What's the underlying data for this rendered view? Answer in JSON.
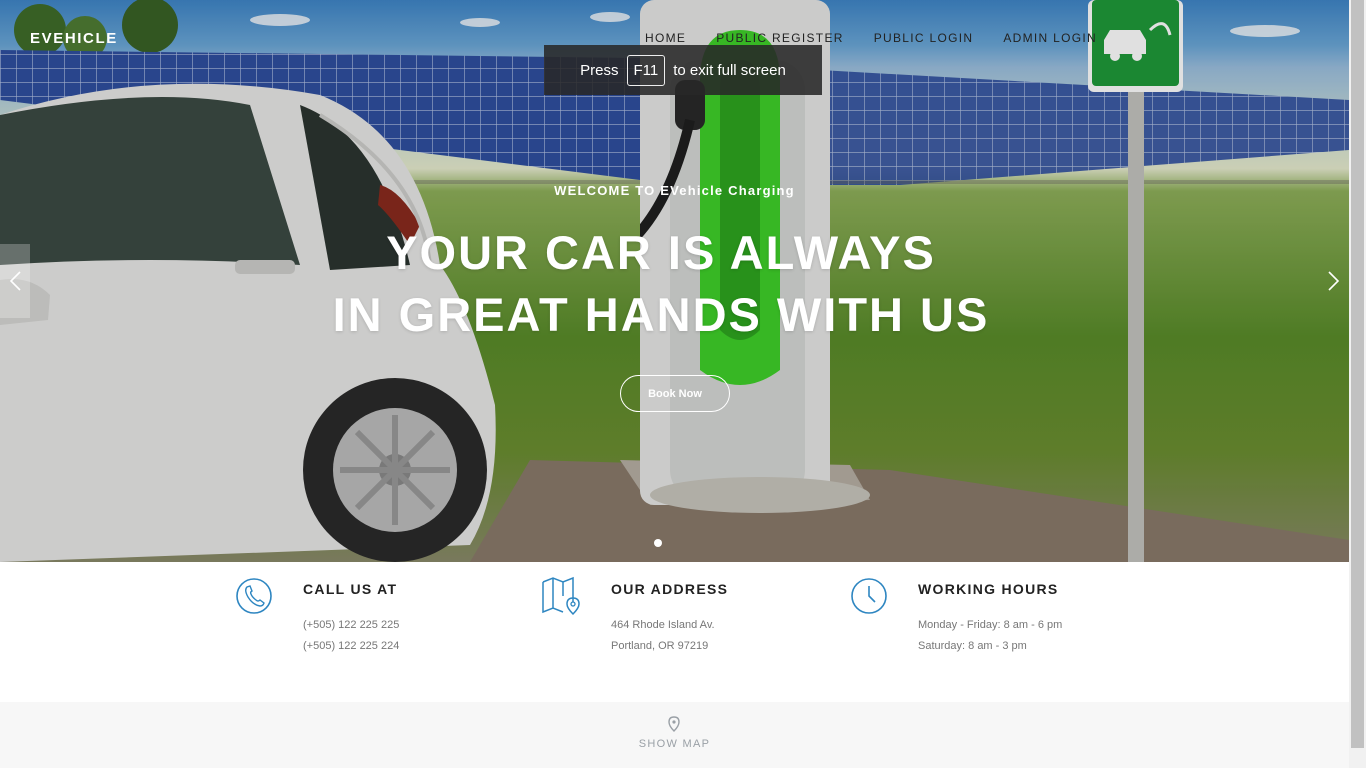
{
  "brand": "EVEHICLE",
  "nav": {
    "home": "HOME",
    "public_register": "PUBLIC REGISTER",
    "public_login": "PUBLIC LOGIN",
    "admin_login": "ADMIN LOGIN"
  },
  "fullscreen_notice": {
    "before": "Press",
    "key": "F11",
    "after": "to exit full screen"
  },
  "hero": {
    "welcome": "WELCOME TO EVehicle Charging",
    "headline_line1": "YOUR CAR IS ALWAYS",
    "headline_line2": "IN GREAT HANDS WITH US",
    "cta": "Book Now",
    "prev_icon": "chevron-left-icon",
    "next_icon": "chevron-right-icon",
    "slide_count": 1,
    "active_slide": 1
  },
  "info": {
    "call": {
      "icon": "phone-icon",
      "title": "CALL US AT",
      "line1": "(+505) 122 225 225",
      "line2": "(+505) 122 225 224"
    },
    "address": {
      "icon": "map-icon",
      "title": "OUR ADDRESS",
      "line1": "464 Rhode Island Av.",
      "line2": "Portland, OR 97219"
    },
    "hours": {
      "icon": "clock-icon",
      "title": "WORKING HOURS",
      "line1": "Monday - Friday: 8 am - 6 pm",
      "line2": "Saturday: 8 am - 3 pm"
    }
  },
  "map": {
    "icon": "map-pin-icon",
    "label": "SHOW MAP"
  },
  "colors": {
    "accent": "#2e86c1",
    "charger_green": "#3fd12a",
    "sign_green": "#1f9a3a"
  }
}
